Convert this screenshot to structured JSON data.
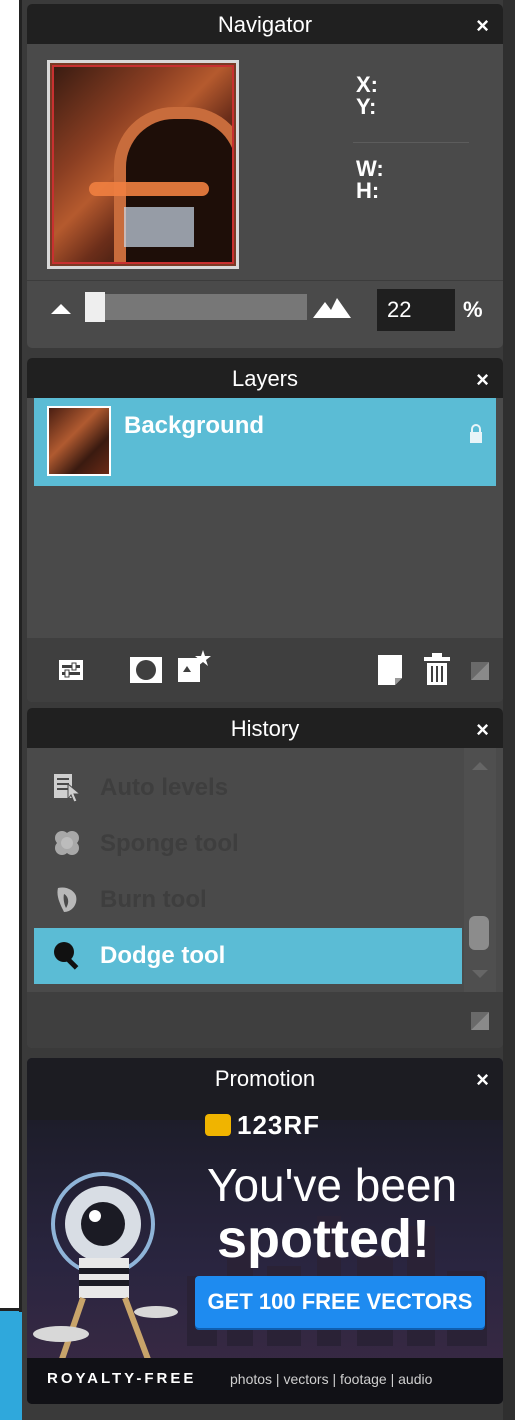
{
  "navigator": {
    "title": "Navigator",
    "close": "×",
    "x_label": "X:",
    "y_label": "Y:",
    "w_label": "W:",
    "h_label": "H:",
    "zoom_value": "22",
    "zoom_unit": "%",
    "zoom_level_fraction": 0.22
  },
  "layers": {
    "title": "Layers",
    "close": "×",
    "items": [
      {
        "name": "Background",
        "locked": true,
        "selected": true
      }
    ]
  },
  "history": {
    "title": "History",
    "close": "×",
    "items": [
      {
        "label": "Auto levels",
        "icon": "levels-icon"
      },
      {
        "label": "Sponge tool",
        "icon": "sponge-icon"
      },
      {
        "label": "Burn tool",
        "icon": "burn-icon"
      },
      {
        "label": "Dodge tool",
        "icon": "dodge-icon",
        "selected": true
      }
    ]
  },
  "promotion": {
    "title": "Promotion",
    "close": "×",
    "brand": "123RF",
    "headline_1": "You've been",
    "headline_2": "spotted!",
    "cta": "GET 100 FREE VECTORS",
    "footer_left": "ROYALTY-FREE",
    "footer_right": "photos | vectors | footage | audio"
  },
  "colors": {
    "selection": "#5bbcd5",
    "panel": "#4a4a4a",
    "header": "#202020",
    "cta": "#1e8bf0",
    "accent_left": "#2fa8dc"
  }
}
